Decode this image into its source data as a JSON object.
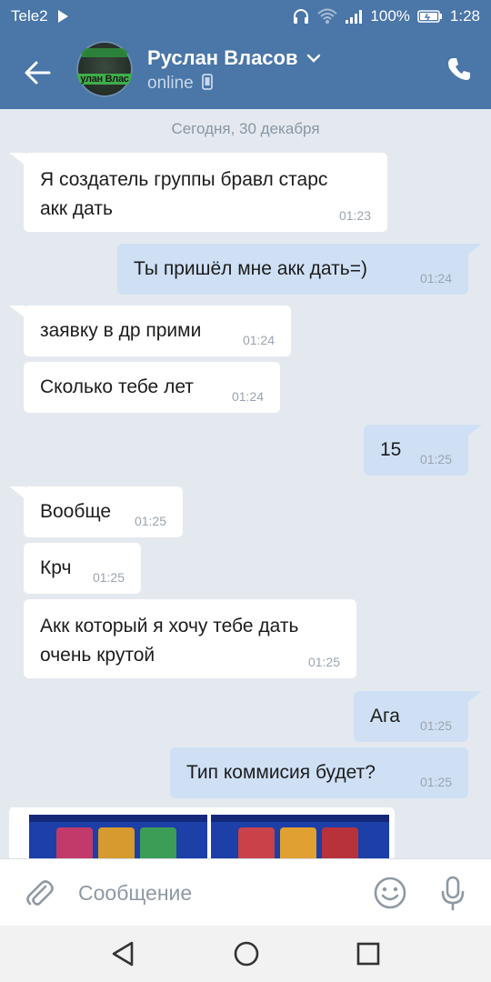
{
  "status_bar": {
    "carrier": "Tele2",
    "battery": "100%",
    "time": "1:28"
  },
  "header": {
    "contact_name": "Руслан Власов",
    "status": "online",
    "avatar_text": "улан Влас"
  },
  "chat": {
    "date_separator": "Сегодня, 30 декабря",
    "messages": [
      {
        "dir": "in",
        "line1": "Я создатель группы бравл старс",
        "line2": "акк дать",
        "time": "01:23"
      },
      {
        "dir": "out",
        "text": "Ты пришёл мне акк дать=)",
        "time": "01:24"
      },
      {
        "dir": "in",
        "text": "заявку в др прими",
        "time": "01:24"
      },
      {
        "dir": "in",
        "text": "Сколько тебе лет",
        "time": "01:24"
      },
      {
        "dir": "out",
        "text": "15",
        "time": "01:25"
      },
      {
        "dir": "in",
        "text": "Вообще",
        "time": "01:25"
      },
      {
        "dir": "in",
        "text": "Крч",
        "time": "01:25"
      },
      {
        "dir": "in",
        "line1": "Акк который я хочу тебе дать",
        "line2": "очень крутой",
        "time": "01:25"
      },
      {
        "dir": "out",
        "text": "Ага",
        "time": "01:25"
      },
      {
        "dir": "out",
        "text": "Тип коммисия будет?",
        "time": "01:25"
      }
    ]
  },
  "input": {
    "placeholder": "Сообщение"
  },
  "icons": {
    "back": "arrow-left-icon",
    "phone": "phone-icon",
    "attach": "paperclip-icon",
    "emoji": "smile-icon",
    "mic": "microphone-icon"
  },
  "colors": {
    "header": "#4a76a8",
    "chat_background": "#e3e9ef",
    "incoming_bubble": "#ffffff",
    "outgoing_bubble": "#cfe0f5"
  }
}
